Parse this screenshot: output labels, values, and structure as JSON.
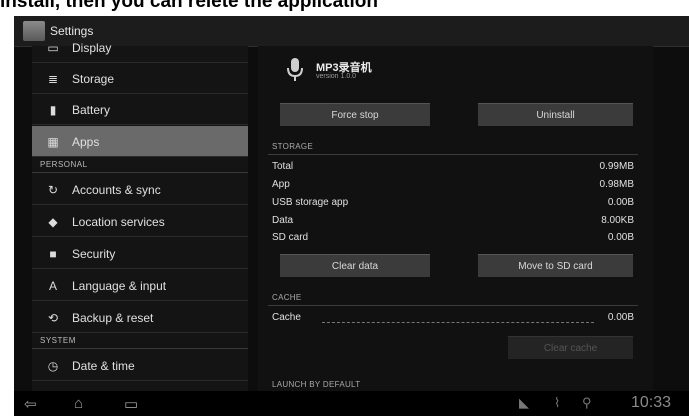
{
  "caption": "install, then you can relete the application",
  "window": {
    "title": "Settings"
  },
  "sidebar": {
    "items": [
      {
        "label": "Display",
        "icon": "display-icon"
      },
      {
        "label": "Storage",
        "icon": "storage-icon"
      },
      {
        "label": "Battery",
        "icon": "battery-icon"
      },
      {
        "label": "Apps",
        "icon": "apps-icon",
        "active": true
      },
      {
        "label": "Accounts & sync",
        "icon": "sync-icon"
      },
      {
        "label": "Location services",
        "icon": "location-icon"
      },
      {
        "label": "Security",
        "icon": "lock-icon"
      },
      {
        "label": "Language & input",
        "icon": "language-icon"
      },
      {
        "label": "Backup & reset",
        "icon": "backup-icon"
      },
      {
        "label": "Date & time",
        "icon": "clock-icon"
      }
    ],
    "headers": {
      "personal": "PERSONAL",
      "system": "SYSTEM"
    }
  },
  "app": {
    "name": "MP3录音机",
    "version": "version 1.0.0"
  },
  "buttons": {
    "force_stop": "Force stop",
    "uninstall": "Uninstall",
    "clear_data": "Clear data",
    "move_to_sd": "Move to SD card",
    "clear_cache": "Clear cache"
  },
  "storage": {
    "header": "STORAGE",
    "rows": [
      {
        "label": "Total",
        "value": "0.99MB"
      },
      {
        "label": "App",
        "value": "0.98MB"
      },
      {
        "label": "USB storage app",
        "value": "0.00B"
      },
      {
        "label": "Data",
        "value": "8.00KB"
      },
      {
        "label": "SD card",
        "value": "0.00B"
      }
    ]
  },
  "cache": {
    "header": "CACHE",
    "label": "Cache",
    "value": "0.00B"
  },
  "launch_header": "LAUNCH BY DEFAULT",
  "status": {
    "time": "10:33"
  },
  "colors": {
    "background": "#0d0d0d",
    "active_item": "#6a6a6a",
    "button": "#3b3b3b"
  }
}
